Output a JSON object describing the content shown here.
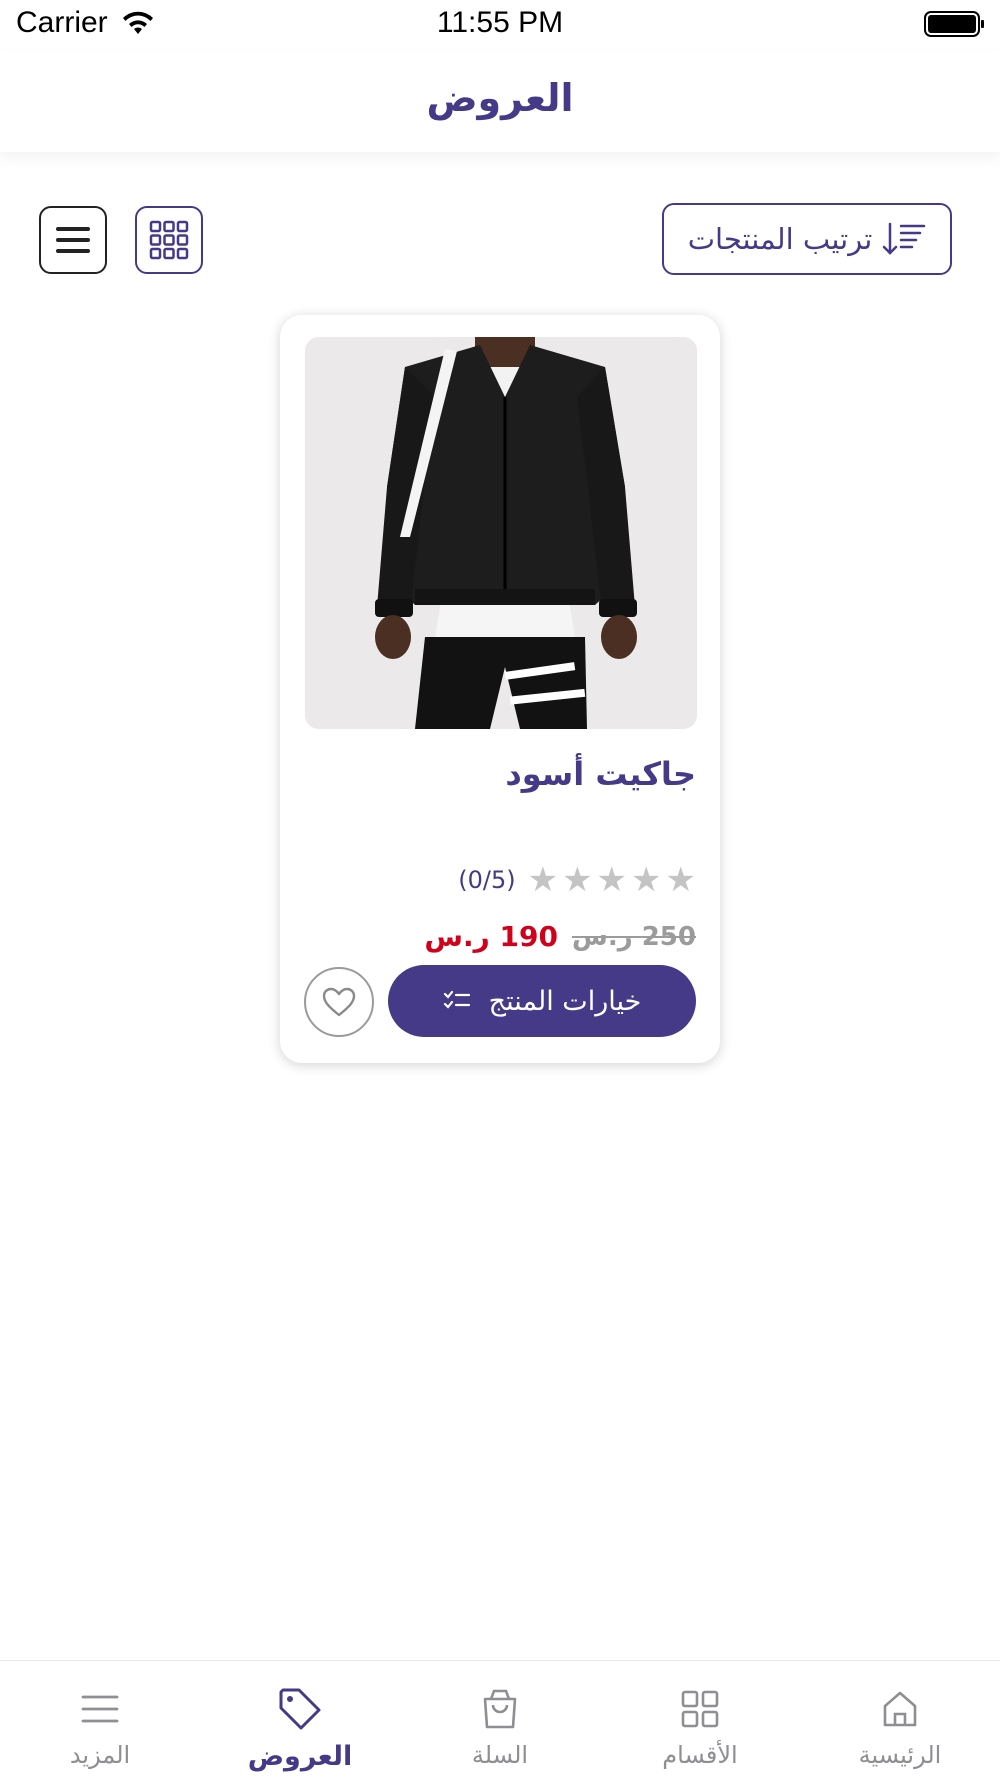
{
  "status_bar": {
    "carrier": "Carrier",
    "time": "11:55 PM"
  },
  "header": {
    "title": "العروض"
  },
  "toolbar": {
    "sort_label": "ترتيب المنتجات"
  },
  "product": {
    "name": "جاكيت أسود",
    "rating_text": "(0/5)",
    "stars_filled": 0,
    "stars_total": 5,
    "price_new": "190 ر.س",
    "price_old": "250 ر.س",
    "options_label": "خيارات المنتج"
  },
  "tabs": [
    {
      "label": "الرئيسية",
      "icon": "home-icon"
    },
    {
      "label": "الأقسام",
      "icon": "categories-icon"
    },
    {
      "label": "السلة",
      "icon": "cart-icon"
    },
    {
      "label": "العروض",
      "icon": "tag-icon",
      "active": true
    },
    {
      "label": "المزيد",
      "icon": "menu-icon"
    }
  ],
  "colors": {
    "primary": "#453a87",
    "sale_price": "#d0021b",
    "inactive": "#8e8e93"
  }
}
